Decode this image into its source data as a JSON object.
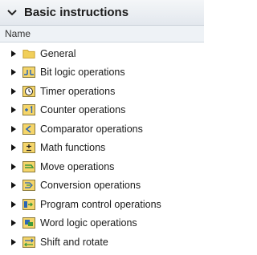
{
  "panel": {
    "title": "Basic instructions",
    "column_header": "Name",
    "items": [
      {
        "label": "General",
        "icon": "folder-icon"
      },
      {
        "label": "Bit logic operations",
        "icon": "bit-logic-icon"
      },
      {
        "label": "Timer operations",
        "icon": "timer-icon"
      },
      {
        "label": "Counter operations",
        "icon": "counter-icon"
      },
      {
        "label": "Comparator operations",
        "icon": "comparator-icon"
      },
      {
        "label": "Math functions",
        "icon": "math-icon"
      },
      {
        "label": "Move operations",
        "icon": "move-icon"
      },
      {
        "label": "Conversion operations",
        "icon": "conversion-icon"
      },
      {
        "label": "Program control operations",
        "icon": "program-control-icon"
      },
      {
        "label": "Word logic operations",
        "icon": "word-logic-icon"
      },
      {
        "label": "Shift and rotate",
        "icon": "shift-rotate-icon"
      }
    ]
  },
  "colors": {
    "header_bg": "#e3e8ee",
    "folder_yellow": "#f1cf5a",
    "icon_yellow": "#f5d56a",
    "icon_blue": "#2b66b3",
    "icon_green": "#3f9a3a"
  }
}
